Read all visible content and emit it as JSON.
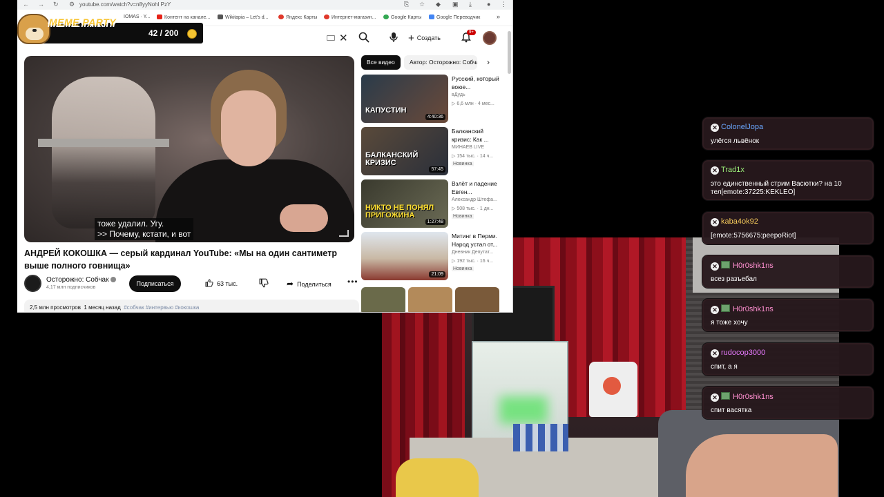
{
  "browser": {
    "url": "youtube.com/watch?v=n8yyNohl PzY",
    "bookmarks": [
      "IOMAS · Y...",
      "Контент на канале...",
      "Wikitapia – Let's d...",
      "Яндекс Карты",
      "Интернет-магазин...",
      "Google Карты",
      "Google Переводчик"
    ],
    "more_bookmarks": "»"
  },
  "youtube": {
    "create_label": "Создать",
    "notif_count": "9+",
    "subtitle_line1": "тоже удалил. Угу.",
    "subtitle_line2": ">> Почему, кстати, и вот",
    "video_title": "АНДРЕЙ КОКОШКА — серый кардинал YouTube: «Мы на один сантиметр выше полного говнища»",
    "channel_name": "Осторожно: Собчак",
    "channel_subs": "4,17 млн подписчиков",
    "subscribe_label": "Подписаться",
    "likes": "63 тыс.",
    "share_label": "Поделиться",
    "views": "2,5 млн просмотров",
    "date": "1 месяц назад",
    "tags": "#собчак #интервью #кокошка",
    "chips": [
      "Все видео",
      "Автор: Осторожно: Собчак"
    ],
    "recommendations": [
      {
        "title": "Русский, который воюе...",
        "channel": "вДудь",
        "meta": "▷ 6,6 млн · 4 мес...",
        "duration": "4:40:36",
        "thumb_text": "КАПУСТИН",
        "new": ""
      },
      {
        "title": "Балканский кризис: Как ...",
        "channel": "МИНАЕВ LIVE",
        "meta": "▷ 154 тыс. · 14 ч...",
        "duration": "57:45",
        "thumb_text": "БАЛКАНСКИЙ КРИЗИС",
        "new": "Новинка"
      },
      {
        "title": "Взлёт и падение Евген...",
        "channel": "Александр Штефа...",
        "meta": "▷ 508 тыс. · 1 дн...",
        "duration": "1:27:48",
        "thumb_text": "НИКТО НЕ ПОНЯЛ ПРИГОЖИНА",
        "new": "Новинка"
      },
      {
        "title": "Митинг в Перми. Народ устал от...",
        "channel": "Дневник Депутат...",
        "meta": "▷ 192 тыс. · 16 ч...",
        "duration": "21:09",
        "thumb_text": "",
        "new": "Новинка"
      }
    ]
  },
  "meme_party": {
    "title": "MEME PARTY",
    "count": "42 / 200"
  },
  "chat": [
    {
      "user": "ColonelJopa",
      "color": "#6aa7ff",
      "emote": false,
      "text": "улёгся львёнок"
    },
    {
      "user": "Trad1x",
      "color": "#9cf07a",
      "emote": false,
      "text": "это единственный стрим Васютки? на 10 тел[emote:37225:KEKLEO]"
    },
    {
      "user": "kaba4ok92",
      "color": "#f2c75a",
      "emote": false,
      "text": "[emote:5756675:peepoRiot]"
    },
    {
      "user": "H0r0shk1ns",
      "color": "#ff8fd0",
      "emote": true,
      "text": "всез разъебал"
    },
    {
      "user": "H0r0shk1ns",
      "color": "#ff8fd0",
      "emote": true,
      "text": "я тоже хочу"
    },
    {
      "user": "rudocop3000",
      "color": "#e87aff",
      "emote": false,
      "text": "спит, а я"
    },
    {
      "user": "H0r0shk1ns",
      "color": "#ff8fd0",
      "emote": true,
      "text": "спит васятка"
    }
  ]
}
